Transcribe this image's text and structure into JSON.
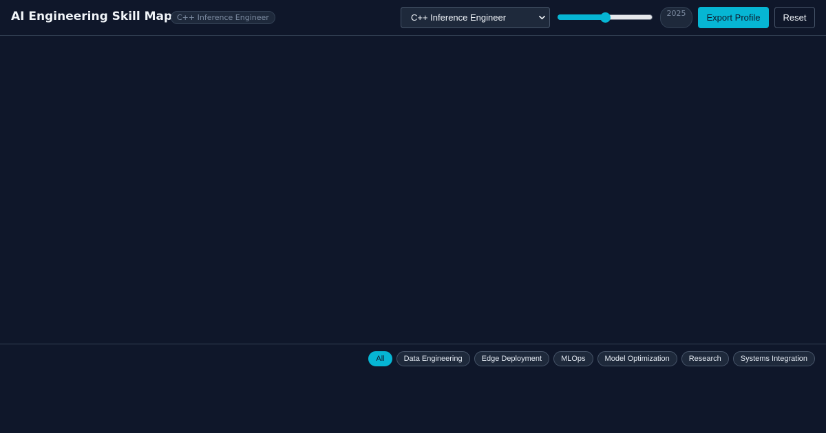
{
  "app": {
    "title": "AI Engineering Skill Map",
    "role_badge": "C++ Inference Engineer"
  },
  "toolbar": {
    "role_select_value": "C++ Inference Engineer",
    "year_slider_level": 0.5,
    "year_label": "2025",
    "export_label": "Export Profile",
    "reset_label": "Reset"
  },
  "filters": {
    "chips": [
      {
        "label": "All",
        "active": true
      },
      {
        "label": "Data Engineering",
        "active": false
      },
      {
        "label": "Edge Deployment",
        "active": false
      },
      {
        "label": "MLOps",
        "active": false
      },
      {
        "label": "Model Optimization",
        "active": false
      },
      {
        "label": "Research",
        "active": false
      },
      {
        "label": "Systems Integration",
        "active": false
      }
    ]
  },
  "colors": {
    "background": "#0f172a",
    "accent": "#06b6d4",
    "border": "#334155"
  },
  "icons": {
    "select_chevron": "chevron-down-icon"
  }
}
